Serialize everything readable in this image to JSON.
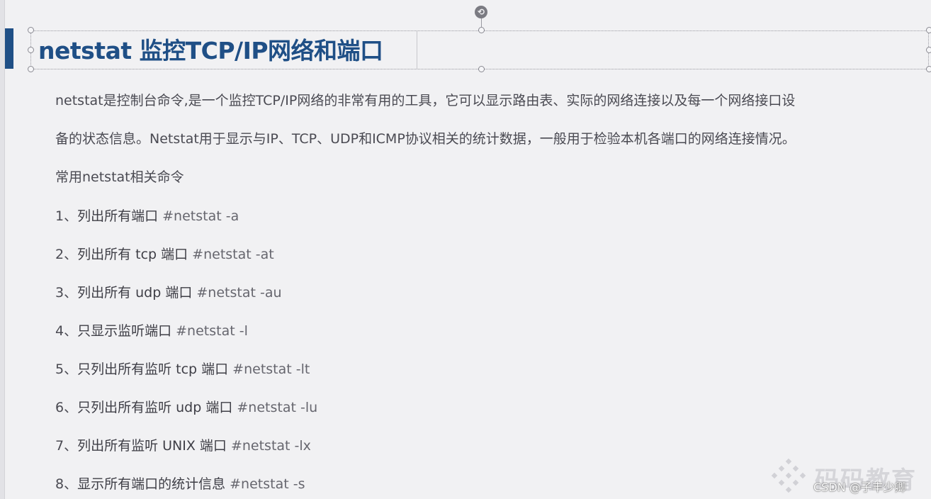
{
  "slide": {
    "title": "netstat 监控TCP/IP网络和端口",
    "paragraph_lines": [
      "netstat是控制台命令,是一个监控TCP/IP网络的非常有用的工具，它可以显示路由表、实际的网络连接以及每一个网络接口设",
      "备的状态信息。Netstat用于显示与IP、TCP、UDP和ICMP协议相关的统计数据，一般用于检验本机各端口的网络连接情况。"
    ],
    "subheading": "常用netstat相关命令",
    "commands": [
      {
        "num": "1、",
        "desc": "列出所有端口 ",
        "code": "#netstat -a"
      },
      {
        "num": "2、",
        "desc": "列出所有 tcp 端口 ",
        "code": "#netstat -at"
      },
      {
        "num": "3、",
        "desc": "列出所有 udp 端口 ",
        "code": "#netstat -au"
      },
      {
        "num": "4、",
        "desc": "只显示监听端口 ",
        "code": "#netstat -l"
      },
      {
        "num": "5、",
        "desc": "只列出所有监听 tcp 端口 ",
        "code": "#netstat -lt"
      },
      {
        "num": "6、",
        "desc": "只列出所有监听 udp 端口 ",
        "code": "#netstat -lu"
      },
      {
        "num": "7、",
        "desc": "列出所有监听 UNIX 端口 ",
        "code": "#netstat -lx"
      },
      {
        "num": "8、",
        "desc": "显示所有端口的统计信息 ",
        "code": "#netstat -s"
      }
    ]
  },
  "watermark": {
    "brand": "码码教育",
    "credit": "CSDN @子丰少卿"
  },
  "colors": {
    "title": "#1f4f86",
    "accent_bar": "#1f4f86",
    "background": "#f1f1f3",
    "body_text": "#4a4a52"
  },
  "icons": {
    "rotate_handle": "rotate-icon",
    "watermark_logo": "brand-logo-icon"
  }
}
